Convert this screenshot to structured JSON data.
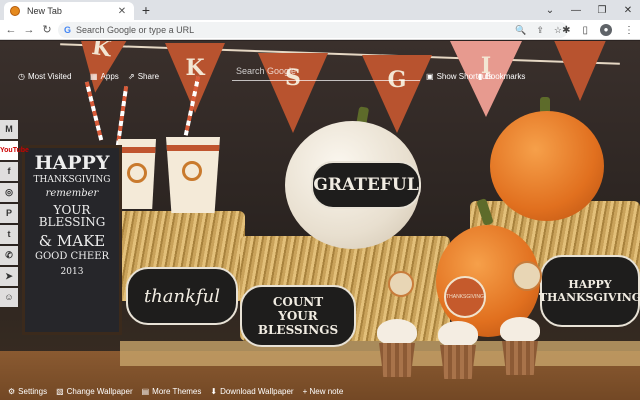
{
  "browser": {
    "tab_title": "New Tab",
    "tab_close": "✕",
    "new_tab": "+",
    "window_controls": [
      "⌄",
      "—",
      "❐",
      "✕"
    ],
    "back": "←",
    "forward": "→",
    "reload": "↻",
    "omnibox_icon": "G",
    "omnibox_placeholder": "Search Google or type a URL",
    "omnibox_icons": [
      "🔍",
      "⇪",
      "☆"
    ],
    "toolbar_icons": [
      "✱",
      "▯"
    ],
    "menu": "⋮",
    "avatar": "●"
  },
  "newtab": {
    "most_visited": "Most Visited",
    "apps": "Apps",
    "share": "Share",
    "search_placeholder": "Search Google",
    "show_shortcuts": "Show Shortcuts",
    "bookmarks": "Bookmarks"
  },
  "sidebar": {
    "items": [
      {
        "icon": "gmail-icon",
        "glyph": "M"
      },
      {
        "icon": "youtube-icon",
        "glyph": "YouTube"
      },
      {
        "icon": "facebook-icon",
        "glyph": "f"
      },
      {
        "icon": "instagram-icon",
        "glyph": "◎"
      },
      {
        "icon": "pinterest-icon",
        "glyph": "P"
      },
      {
        "icon": "twitter-icon",
        "glyph": "t"
      },
      {
        "icon": "whatsapp-icon",
        "glyph": "✆"
      },
      {
        "icon": "telegram-icon",
        "glyph": "➤"
      },
      {
        "icon": "reddit-icon",
        "glyph": "☺"
      }
    ]
  },
  "wallpaper": {
    "pennants": [
      "K",
      "S",
      "G",
      "I"
    ],
    "labels": {
      "grateful": "GRATEFUL",
      "thankful": "thankful",
      "count_blessings": "COUNT YOUR BLESSINGS",
      "happy_thanksgiving": "HAPPY THANKSGIVING",
      "cupcake_pick": "THANKSGIVING"
    },
    "chalkboard": [
      "HAPPY",
      "THANKSGIVING",
      "remember",
      "YOUR BLESSING",
      "& MAKE",
      "GOOD CHEER",
      "2013"
    ]
  },
  "bottom_bar": {
    "settings": "Settings",
    "change_wallpaper": "Change Wallpaper",
    "more_themes": "More Themes",
    "download_wallpaper": "Download Wallpaper",
    "new_note": "+ New note"
  },
  "colors": {
    "pennant": "#b8532f",
    "pennant_pink": "#e79a8f",
    "pumpkin_orange": "#e1701f",
    "pumpkin_white": "#efe8dc",
    "chalk_label_bg": "#1e1d1c"
  }
}
